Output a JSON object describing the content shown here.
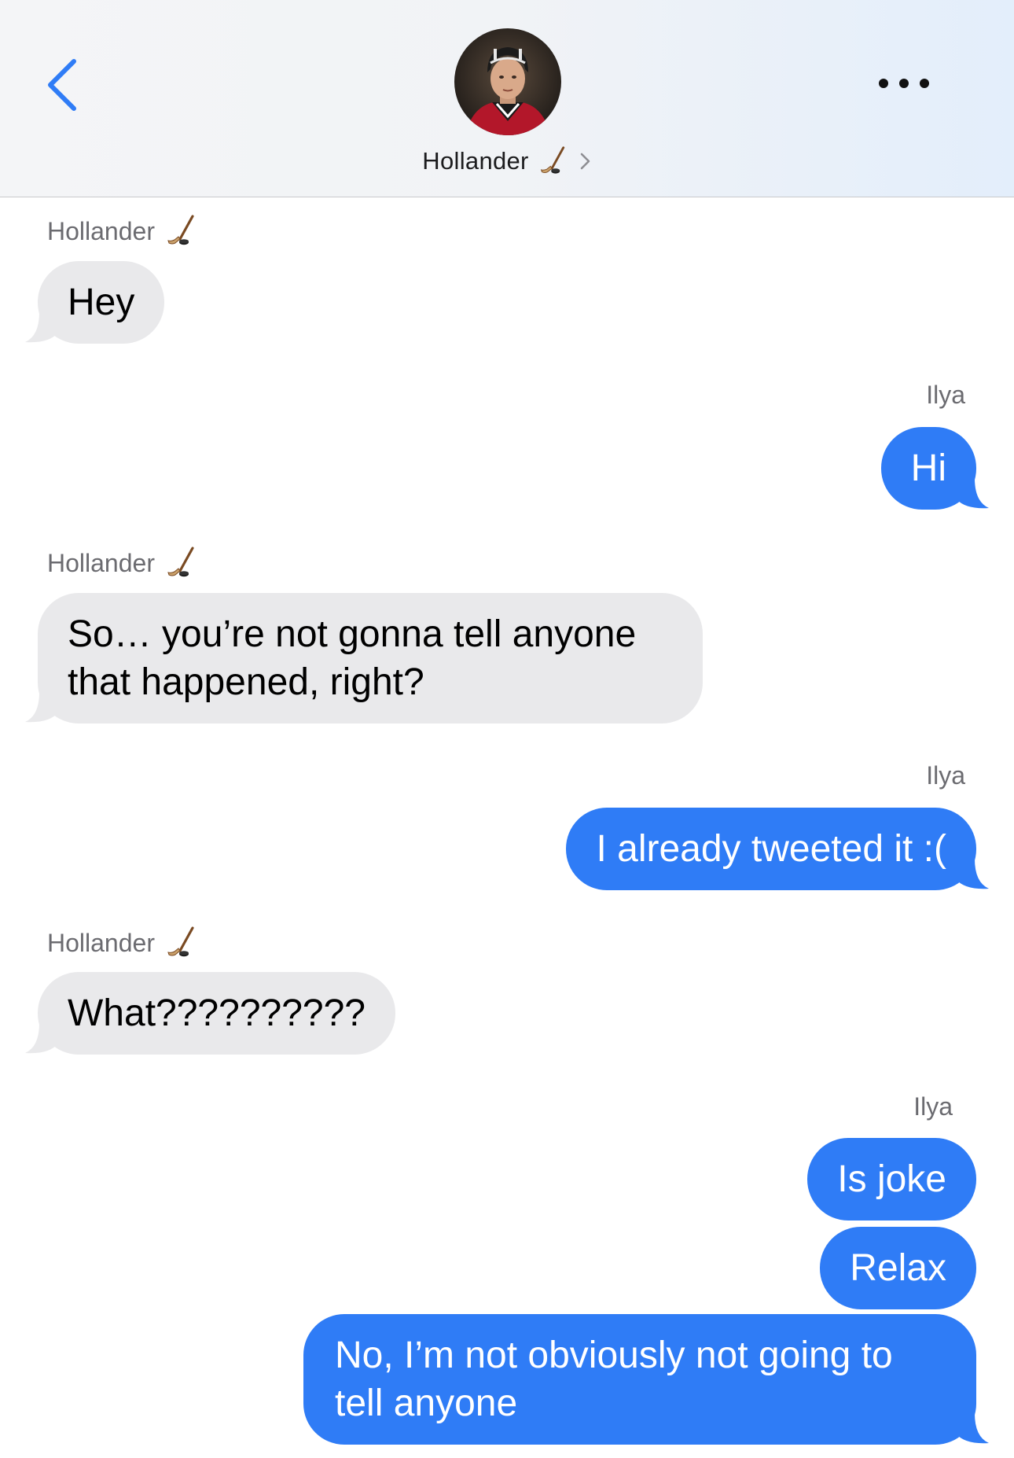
{
  "header": {
    "contact_name": "Hollander",
    "contact_emoji": "hockey-stick-icon",
    "back_icon": "chevron-left-icon",
    "more_icon": "ellipsis-icon",
    "accent_color": "#2f7cf6"
  },
  "messages": [
    {
      "direction": "incoming",
      "sender": "Hollander",
      "text": "Hey"
    },
    {
      "direction": "outgoing",
      "sender": "Ilya",
      "text": "Hi"
    },
    {
      "direction": "incoming",
      "sender": "Hollander",
      "text": "So… you’re not gonna tell anyone that happened, right?"
    },
    {
      "direction": "outgoing",
      "sender": "Ilya",
      "text": "I already tweeted it :("
    },
    {
      "direction": "incoming",
      "sender": "Hollander",
      "text": "What??????????"
    },
    {
      "direction": "outgoing",
      "sender": "Ilya",
      "text": "Is joke"
    },
    {
      "direction": "outgoing",
      "sender": "Ilya",
      "text": "Relax"
    },
    {
      "direction": "outgoing",
      "sender": "Ilya",
      "text": "No, I’m not obviously not going to tell anyone"
    }
  ],
  "colors": {
    "incoming_bubble": "#e9e9eb",
    "outgoing_bubble": "#2f7cf6",
    "sender_label": "#6b6b70"
  }
}
